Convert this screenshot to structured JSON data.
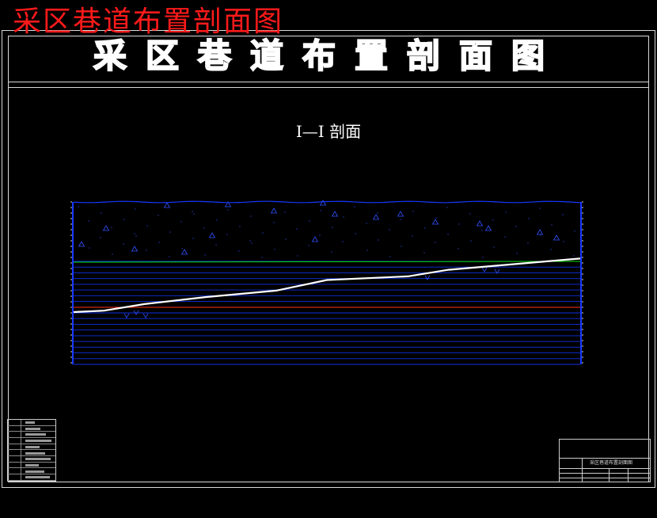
{
  "overlay_title": "采区巷道布置剖面图",
  "banner_title": "采区巷道布置剖面图",
  "section_title": "I—I 剖面",
  "title_block": {
    "drawing_name": "采区巷道布置剖面图"
  },
  "colors": {
    "overlay_title": "#ff1a1a",
    "frame": "#d8d8d8",
    "strata_lines": "#1030e0",
    "ground_line": "#00dd00",
    "seam_line": "#ffffff",
    "red_line": "#ff2a00",
    "rock_symbols": "#3050ff"
  },
  "section": {
    "strata_line_count": 19,
    "seam_profile": [
      [
        0,
        0.0
      ],
      [
        0.06,
        0.4
      ],
      [
        0.14,
        2.2
      ],
      [
        0.26,
        4.1
      ],
      [
        0.4,
        5.9
      ],
      [
        0.5,
        8.8
      ],
      [
        0.66,
        9.8
      ],
      [
        0.74,
        11.6
      ],
      [
        0.84,
        12.8
      ],
      [
        0.94,
        14.0
      ],
      [
        1.0,
        14.7
      ]
    ],
    "ground_level": 14.0,
    "red_level": 1.4
  }
}
